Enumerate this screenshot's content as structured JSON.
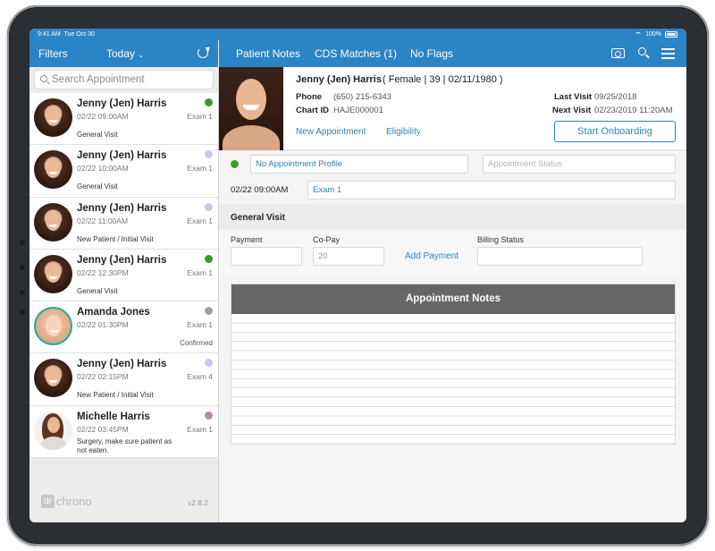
{
  "status_bar": {
    "time": "9:41 AM",
    "date": "Tue Oct 30",
    "battery": "100%"
  },
  "left_header": {
    "filters": "Filters",
    "today": "Today"
  },
  "right_header": {
    "tabs": [
      "Patient Notes",
      "CDS Matches (1)",
      "No Flags"
    ]
  },
  "search": {
    "placeholder": "Search Appointment"
  },
  "appointments": [
    {
      "name": "Jenny (Jen) Harris",
      "time": "02/22 09:00AM",
      "exam": "Exam 1",
      "desc": "General Visit",
      "status": "",
      "dot": "#3b9a2c"
    },
    {
      "name": "Jenny (Jen) Harris",
      "time": "02/22 10:00AM",
      "exam": "Exam 1",
      "desc": "General Visit",
      "status": "",
      "dot": "#c9c7f0"
    },
    {
      "name": "Jenny (Jen) Harris",
      "time": "02/22 11:00AM",
      "exam": "Exam 1",
      "desc": "New Patient / Initial Visit",
      "status": "",
      "dot": "#c9c7f0"
    },
    {
      "name": "Jenny (Jen) Harris",
      "time": "02/22 12:30PM",
      "exam": "Exam 1",
      "desc": "General Visit",
      "status": "",
      "dot": "#3b9a2c"
    },
    {
      "name": "Amanda Jones",
      "time": "02/22 01:30PM",
      "exam": "Exam 1",
      "desc": "",
      "status": "Confirmed",
      "dot": "#9aa0a6"
    },
    {
      "name": "Jenny (Jen) Harris",
      "time": "02/22 02:15PM",
      "exam": "Exam 4",
      "desc": "New Patient / Initial Visit",
      "status": "",
      "dot": "#c9c7f0"
    },
    {
      "name": "Michelle Harris",
      "time": "02/22 03:45PM",
      "exam": "Exam 1",
      "desc": "Surgery, make sure patient as not eaten.",
      "status": "",
      "dot": "#b58aae"
    }
  ],
  "footer": {
    "logo_dr": "dr",
    "logo_name": "chrono",
    "version": "v2.8.2"
  },
  "patient": {
    "name": "Jenny (Jen) Harris",
    "demographics": "( Female | 39 | 02/11/1980 )",
    "phone_label": "Phone",
    "phone": "(650) 215-6343",
    "chart_label": "Chart ID",
    "chart_id": "HAJE000001",
    "last_visit_label": "Last Visit",
    "last_visit": "09/25/2018",
    "next_visit_label": "Next Visit",
    "next_visit": "02/23/2019 11:20AM",
    "new_appointment": "New Appointment",
    "eligibility": "Eligibility",
    "start_onboarding": "Start Onboarding"
  },
  "form": {
    "profile": "No Appointment Profile",
    "status_placeholder": "Appointment Status",
    "datetime": "02/22 09:00AM",
    "exam": "Exam 1",
    "section_title": "General Visit",
    "payment_label": "Payment",
    "copay_label": "Co-Pay",
    "copay_value": "20",
    "add_payment": "Add Payment",
    "billing_label": "Billing Status",
    "notes_title": "Appointment Notes"
  },
  "colors": {
    "accent": "#2b84c6",
    "status_green": "#3b9a2c"
  }
}
